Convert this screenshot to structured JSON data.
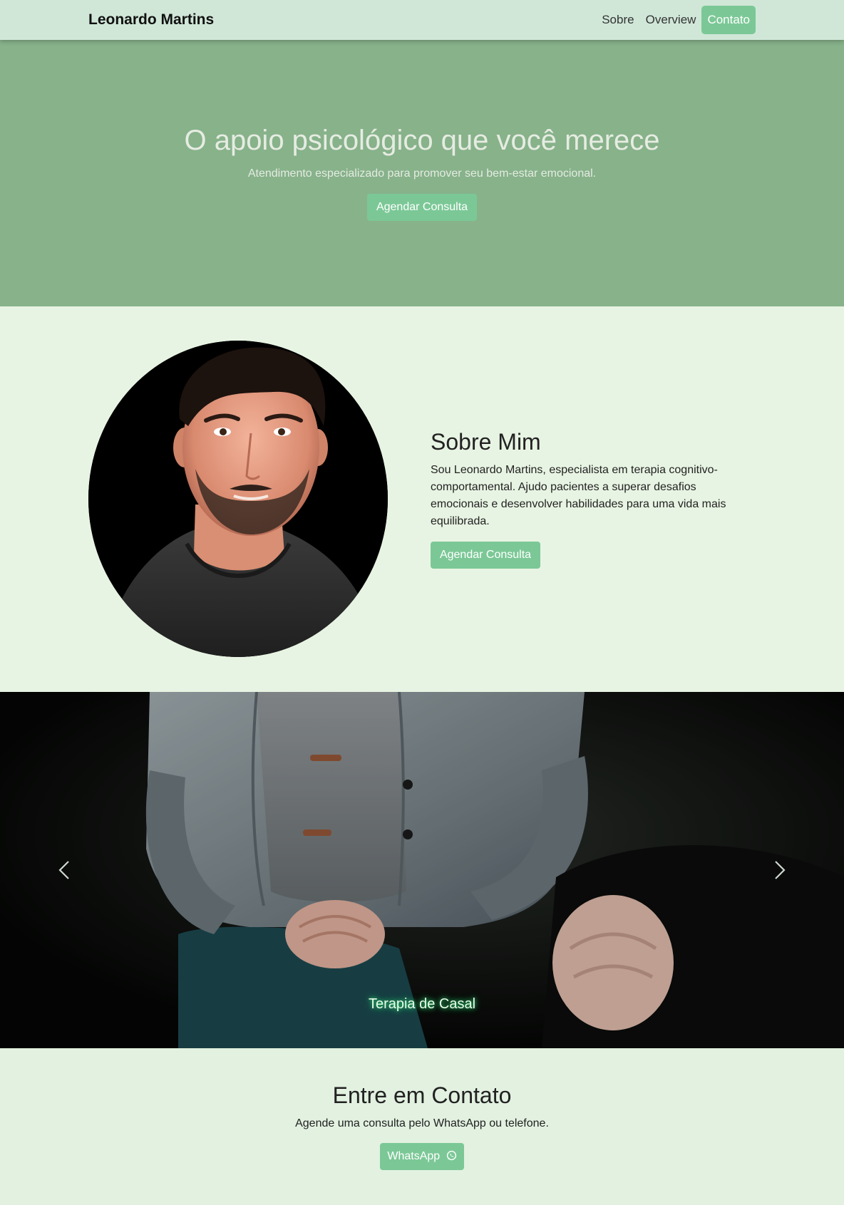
{
  "navbar": {
    "brand": "Leonardo Martins",
    "links": [
      {
        "label": "Sobre"
      },
      {
        "label": "Overview"
      },
      {
        "label": "Contato"
      }
    ]
  },
  "hero": {
    "title": "O apoio psicológico que você merece",
    "subtitle": "Atendimento especializado para promover seu bem-estar emocional.",
    "cta": "Agendar Consulta"
  },
  "about": {
    "title": "Sobre Mim",
    "text": "Sou Leonardo Martins, especialista em terapia cognitivo-comportamental. Ajudo pacientes a superar desafios emocionais e desenvolver habilidades para uma vida mais equilibrada.",
    "cta": "Agendar Consulta"
  },
  "carousel": {
    "caption": "Terapia de Casal",
    "prev_icon": "chevron-left-icon",
    "next_icon": "chevron-right-icon"
  },
  "contact": {
    "title": "Entre em Contato",
    "text": "Agende uma consulta pelo WhatsApp ou telefone.",
    "cta": "WhatsApp",
    "cta_icon": "whatsapp-icon"
  },
  "colors": {
    "accent": "#7bc896",
    "hero_bg": "#87b28a",
    "navbar_bg": "#d0e7d8",
    "about_bg": "#e8f4e3",
    "contact_bg": "#e2f1e0"
  }
}
